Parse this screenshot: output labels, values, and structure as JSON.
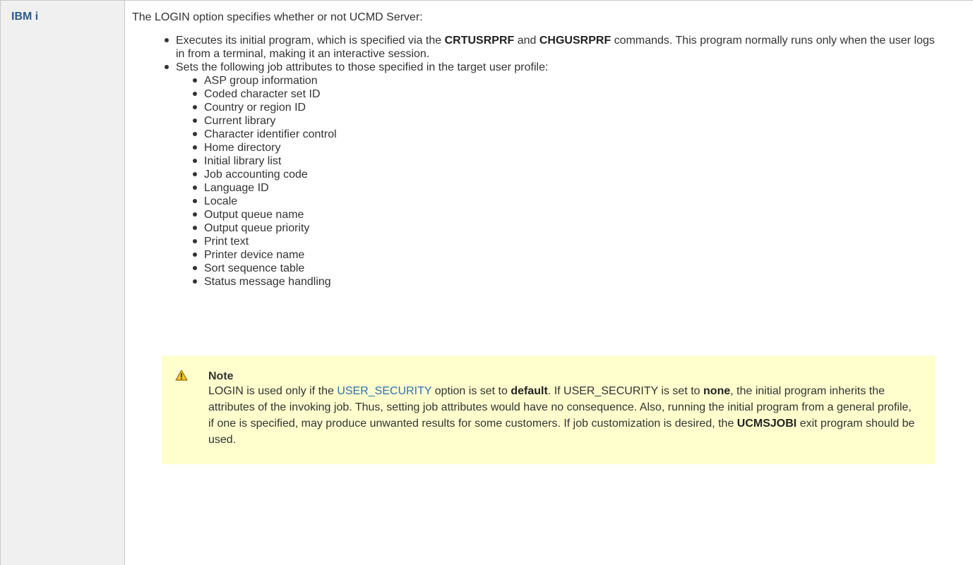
{
  "row": {
    "header": "IBM i",
    "intro": "The LOGIN option specifies whether or not UCMD Server:",
    "bullets": {
      "b1": {
        "pre": "Executes its initial program, which is specified via the ",
        "bold1": "CRTUSRPRF",
        "mid": " and ",
        "bold2": "CHGUSRPRF",
        "post": " commands. This program normally runs only when the user logs in from a terminal, making it an interactive session."
      },
      "b2": "Sets the following job attributes to those specified in the target user profile:"
    },
    "attributes": [
      "ASP group information",
      "Coded character set ID",
      "Country or region ID",
      "Current library",
      "Character identifier control",
      "Home directory",
      "Initial library list",
      "Job accounting code",
      "Language ID",
      "Locale",
      "Output queue name",
      "Output queue priority",
      "Print text",
      "Printer device name",
      "Sort sequence table",
      "Status message handling"
    ],
    "note": {
      "icon": "warning-icon",
      "title": "Note",
      "t1": "LOGIN is used only if the ",
      "link": "USER_SECURITY",
      "t2": " option is set to ",
      "bold1": "default",
      "t3": ". If USER_SECURITY is set to ",
      "bold2": "none",
      "t4": ", the initial program inherits the attributes of the invoking job. Thus, setting job attributes would have no consequence. Also, running the initial program from a general profile, if one is specified, may produce unwanted results for some customers. If job customization is desired, the ",
      "bold3": "UCMSJOBI",
      "t5": " exit program should be used."
    },
    "colors": {
      "header_bg": "#f0f0f0",
      "header_text": "#2c5a8a",
      "note_bg": "#ffffce",
      "link": "#2f6fb0"
    }
  }
}
